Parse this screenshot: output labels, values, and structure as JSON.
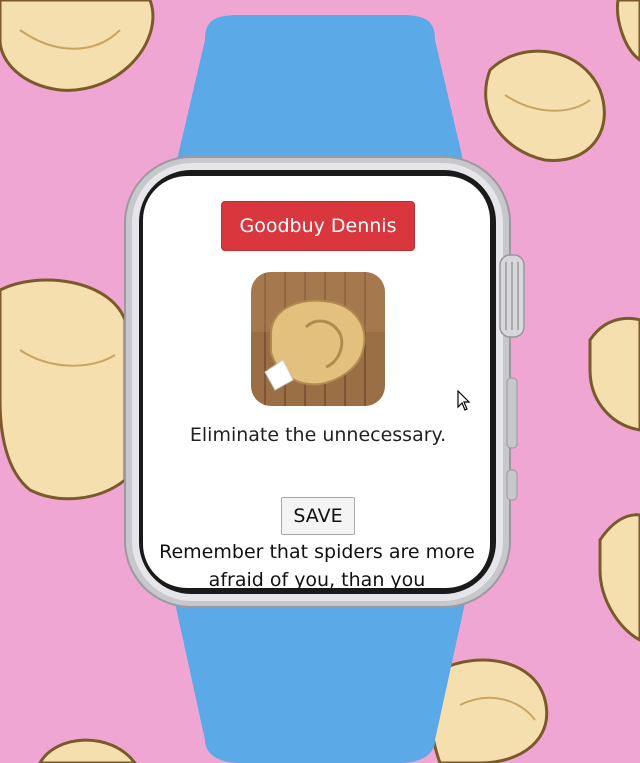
{
  "colors": {
    "background": "#f0a6d2",
    "band": "#5ba9e6",
    "primary_button": "#d9363e"
  },
  "watch": {
    "header_button": "Goodbuy Dennis",
    "app_icon": "fortune-cookie-icon",
    "fortune_text": "Eliminate the unnecessary.",
    "save_label": "SAVE",
    "message": "Remember that spiders are more afraid of you, than you"
  }
}
